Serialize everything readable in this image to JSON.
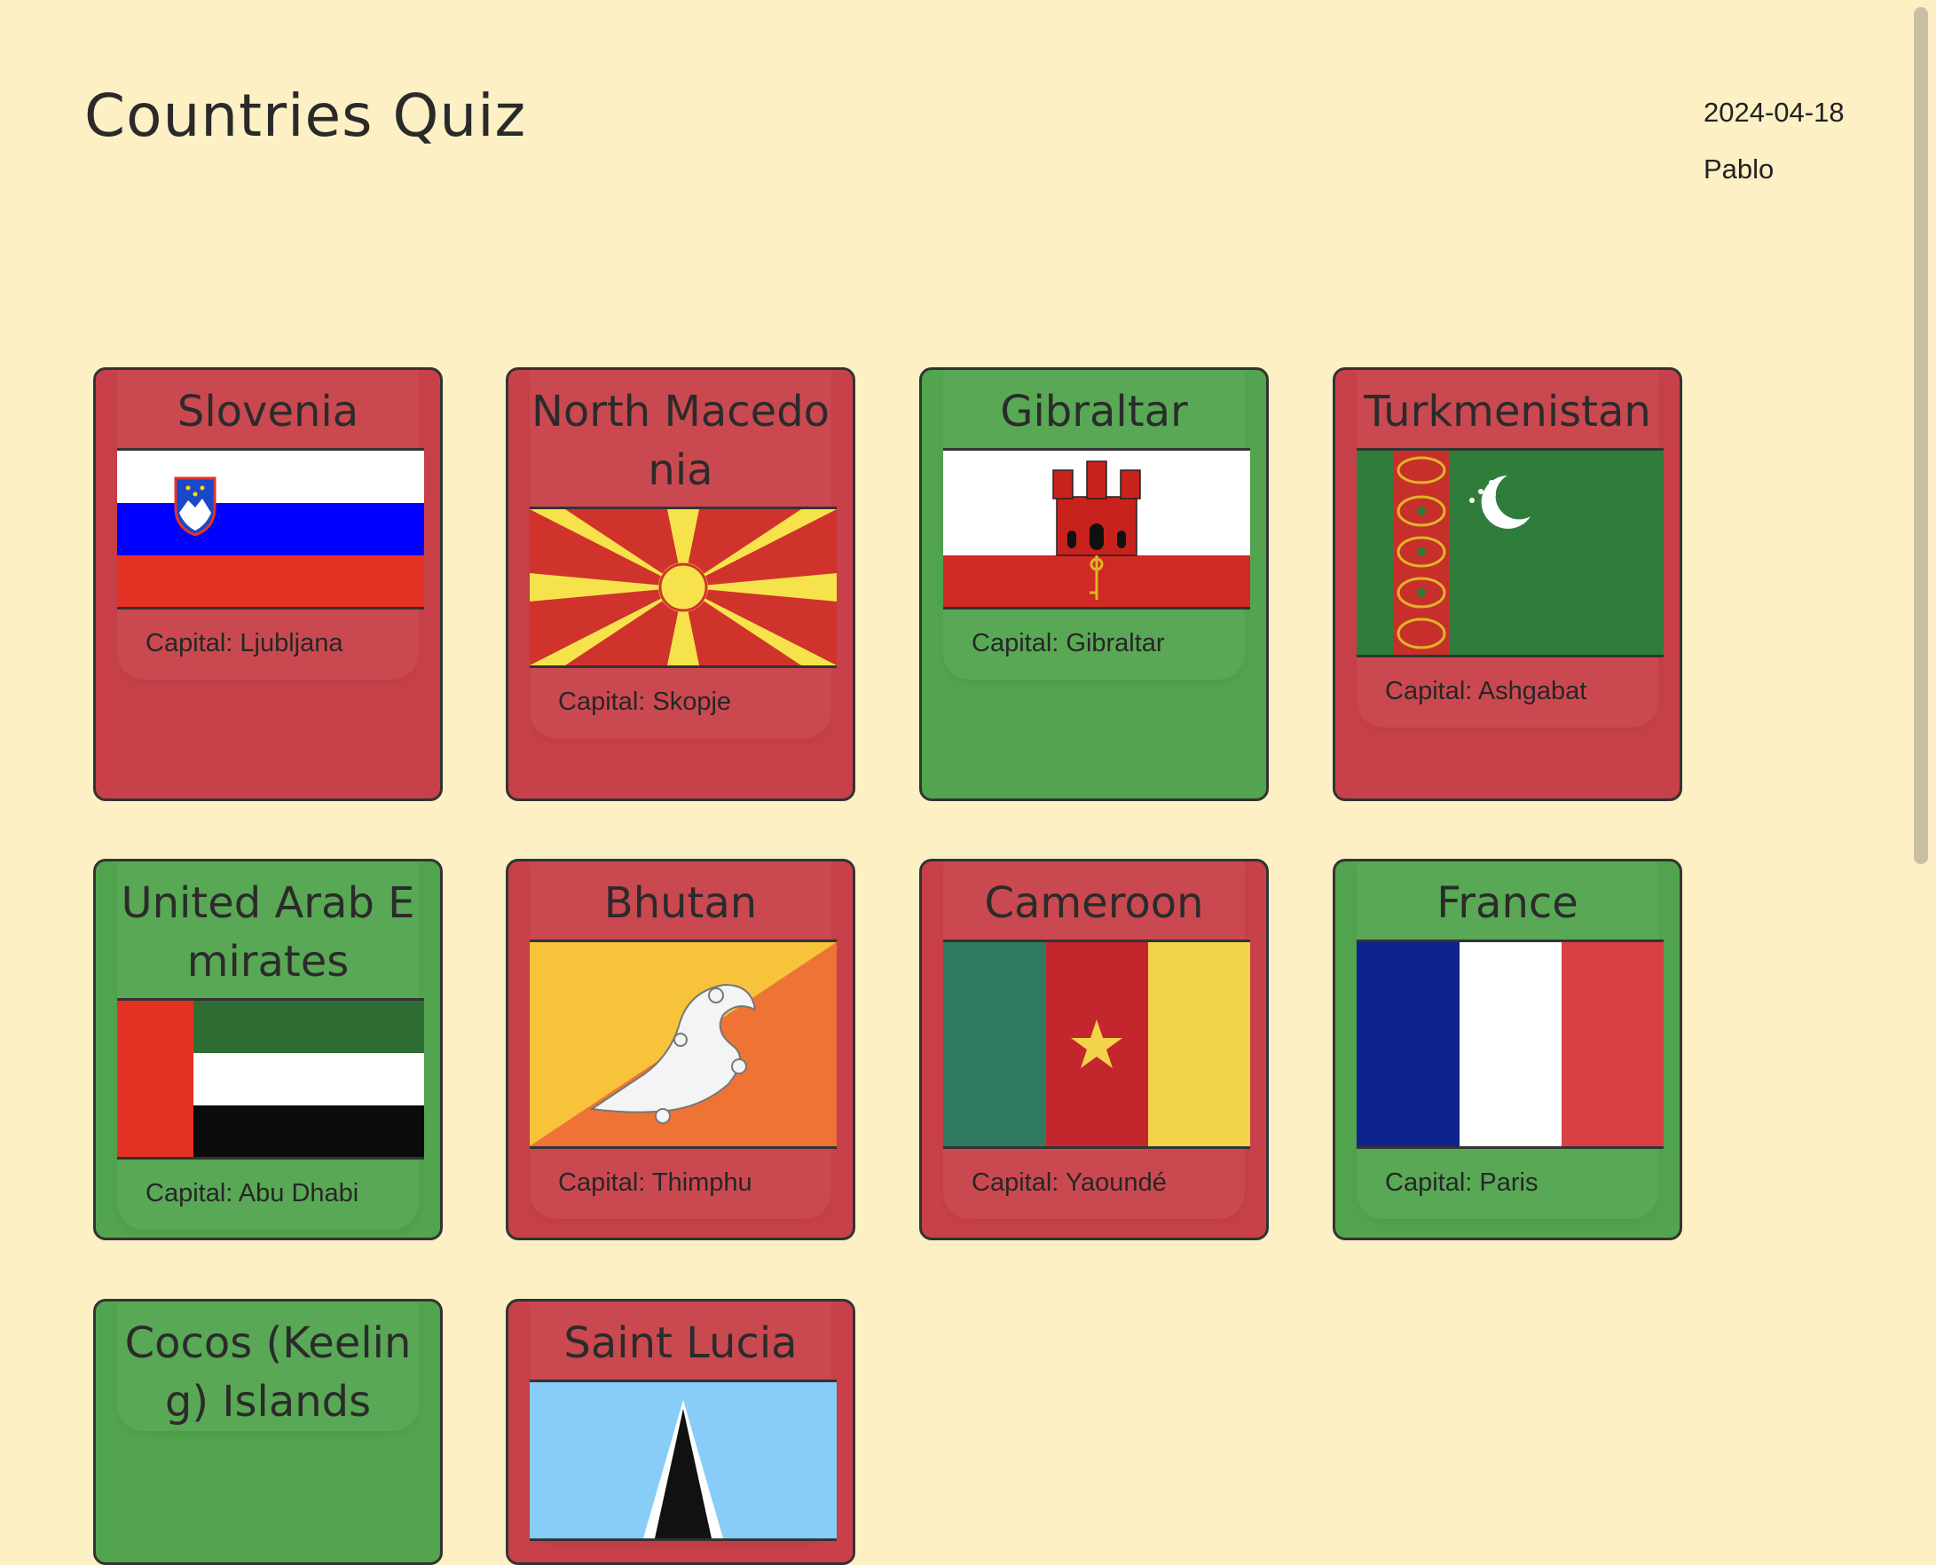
{
  "header": {
    "title": "Countries Quiz",
    "date": "2024-04-18",
    "user": "Pablo"
  },
  "cards": [
    {
      "country": "Slovenia",
      "capital": "Capital: Ljubljana",
      "result": "wrong",
      "flag_icon": "slovenia-flag"
    },
    {
      "country": "North Macedonia",
      "capital": "Capital: Skopje",
      "result": "wrong",
      "flag_icon": "north-macedonia-flag"
    },
    {
      "country": "Gibraltar",
      "capital": "Capital: Gibraltar",
      "result": "correct",
      "flag_icon": "gibraltar-flag"
    },
    {
      "country": "Turkmenistan",
      "capital": "Capital: Ashgabat",
      "result": "wrong",
      "flag_icon": "turkmenistan-flag"
    },
    {
      "country": "United Arab Emirates",
      "capital": "Capital: Abu Dhabi",
      "result": "correct",
      "flag_icon": "uae-flag"
    },
    {
      "country": "Bhutan",
      "capital": "Capital: Thimphu",
      "result": "wrong",
      "flag_icon": "bhutan-flag"
    },
    {
      "country": "Cameroon",
      "capital": "Capital: Yaoundé",
      "result": "wrong",
      "flag_icon": "cameroon-flag"
    },
    {
      "country": "France",
      "capital": "Capital: Paris",
      "result": "correct",
      "flag_icon": "france-flag"
    },
    {
      "country": "Cocos (Keeling) Islands",
      "capital": "",
      "result": "correct",
      "flag_icon": "cocos-islands-flag"
    },
    {
      "country": "Saint Lucia",
      "capital": "",
      "result": "wrong",
      "flag_icon": "saint-lucia-flag"
    }
  ],
  "colors": {
    "background": "#fcf0c4",
    "correct": "#52a54e",
    "wrong": "#c8414a"
  }
}
